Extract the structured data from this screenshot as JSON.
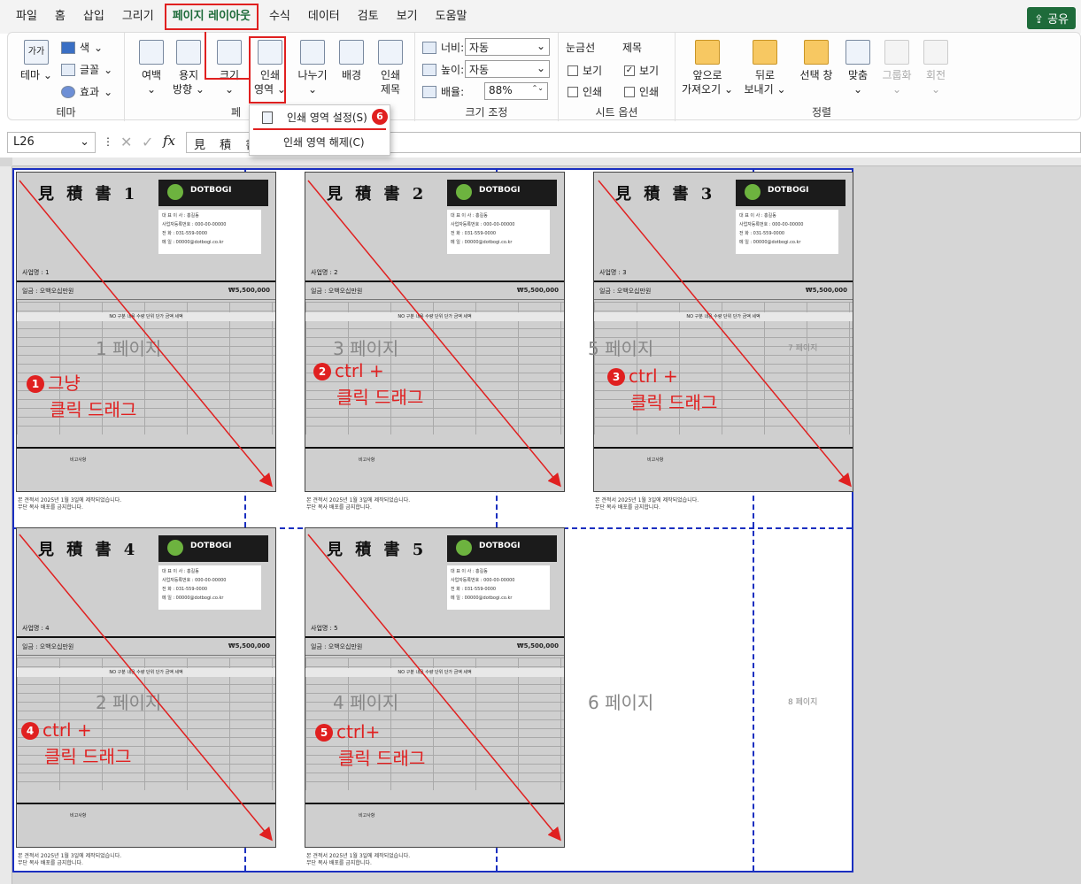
{
  "menu": {
    "tabs": [
      "파일",
      "홈",
      "삽입",
      "그리기",
      "페이지 레이아웃",
      "수식",
      "데이터",
      "검토",
      "보기",
      "도움말"
    ],
    "active": "페이지 레이아웃",
    "share": "공유"
  },
  "ribbon": {
    "theme": {
      "themes": "테마",
      "colors": "색",
      "fonts": "글꼴",
      "effects": "효과",
      "label": "테마",
      "theme_icon_text": "가가"
    },
    "page_setup": {
      "margins": "여백",
      "orientation_line1": "용지",
      "orientation_line2": "방향",
      "size": "크기",
      "print_area_line1": "인쇄",
      "print_area_line2": "영역",
      "breaks": "나누기",
      "background": "배경",
      "print_titles_line1": "인쇄",
      "print_titles_line2": "제목",
      "label": "페"
    },
    "scale": {
      "width_label": "너비:",
      "width_value": "자동",
      "height_label": "높이:",
      "height_value": "자동",
      "scale_label": "배율:",
      "scale_value": "88%",
      "label": "크기 조정"
    },
    "sheet_options": {
      "gridlines": "눈금선",
      "headings": "제목",
      "view": "보기",
      "print": "인쇄",
      "label": "시트 옵션"
    },
    "arrange": {
      "bring_forward_line1": "앞으로",
      "bring_forward_line2": "가져오기",
      "send_backward_line1": "뒤로",
      "send_backward_line2": "보내기",
      "selection_pane": "선택 창",
      "align": "맞춤",
      "group": "그룹화",
      "rotate": "회전",
      "label": "정렬"
    }
  },
  "print_area_menu": {
    "set": "인쇄 영역 설정(S)",
    "clear": "인쇄 영역 해제(C)",
    "badge": "6"
  },
  "formula_bar": {
    "cell": "L26",
    "content": "見 積 書"
  },
  "sheet": {
    "pages": [
      {
        "title": "見 積 書 1",
        "project": "사업명 : 1"
      },
      {
        "title": "見 積 書 2",
        "project": "사업명 : 2"
      },
      {
        "title": "見 積 書 3",
        "project": "사업명 : 3"
      },
      {
        "title": "見 積 書 4",
        "project": "사업명 : 4"
      },
      {
        "title": "見 積 書 5",
        "project": "사업명 : 5"
      }
    ],
    "logo": "DOTBOGI",
    "amount_label": "일금 : 오백오십만원",
    "amount": "₩5,500,000",
    "table_title": "견적내용",
    "table_headers": "NO  구분  내용  수량  단위  단가  금액  세액",
    "remarks_title": "비고사항",
    "info_lines": [
      "대 표 이 사 : 홍길동",
      "사업자등록번호 : 000-00-00000",
      "전 화 : 031-559-0000",
      "메 일 : 00000@dotbogi.co.kr"
    ],
    "footer_line1": "본 견적서 2025년 1월 3일에 제작되었습니다.",
    "footer_line2": "무단 복사 배포를 금지합니다.",
    "page_labels": {
      "p1": "1 페이지",
      "p2": "2 페이지",
      "p3": "3 페이지",
      "p4": "4 페이지",
      "p5": "5 페이지",
      "p6": "6 페이지",
      "p7": "7 페이지",
      "p8": "8 페이지"
    },
    "annotations": [
      {
        "badge": "1",
        "line1": "그냥",
        "line2": "클릭 드래그"
      },
      {
        "badge": "2",
        "line1": "ctrl +",
        "line2": "클릭 드래그"
      },
      {
        "badge": "3",
        "line1": "ctrl +",
        "line2": "클릭 드래그"
      },
      {
        "badge": "4",
        "line1": "ctrl +",
        "line2": "클릭 드래그"
      },
      {
        "badge": "5",
        "line1": "ctrl+",
        "line2": "클릭 드래그"
      }
    ]
  }
}
